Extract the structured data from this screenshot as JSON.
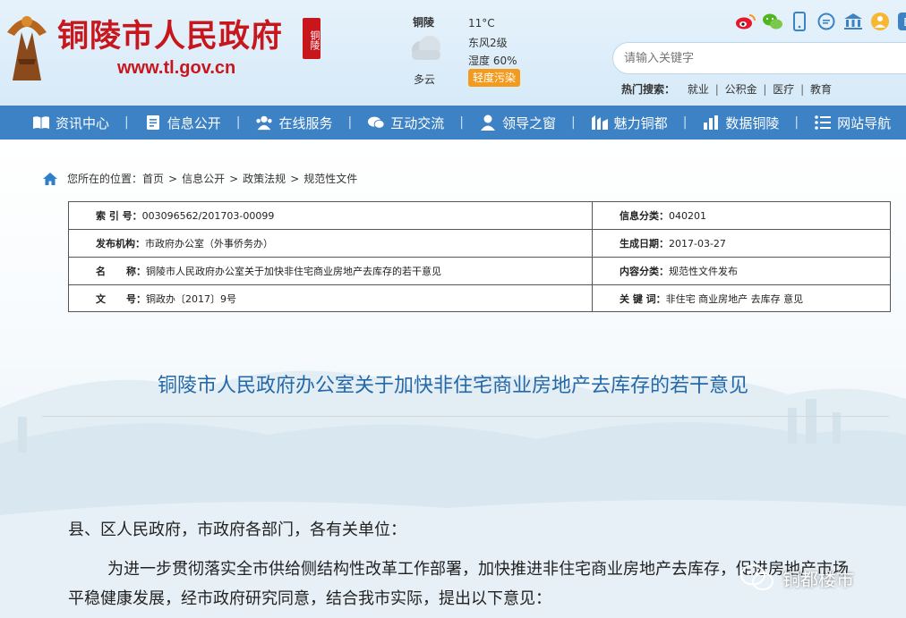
{
  "header": {
    "site_name": "铜陵市人民政府",
    "seal_text": "铜陵",
    "url": "www.tl.gov.cn"
  },
  "weather": {
    "city": "铜陵",
    "condition": "多云",
    "temperature": "11°C",
    "wind": "东风2级",
    "humidity": "湿度 60%",
    "air_quality": "轻度污染"
  },
  "search": {
    "placeholder": "请输入关键字",
    "hot_label": "热门搜索：",
    "hot_keywords": [
      "就业",
      "公积金",
      "医疗",
      "教育"
    ]
  },
  "social_icons": [
    "weibo-icon",
    "wechat-icon",
    "mobile-icon",
    "chat-icon",
    "gov-building-icon",
    "elderly-mode-icon",
    "english-icon"
  ],
  "nav": [
    {
      "label": "资讯中心",
      "icon": "book-icon"
    },
    {
      "label": "信息公开",
      "icon": "document-icon"
    },
    {
      "label": "在线服务",
      "icon": "people-icon"
    },
    {
      "label": "互动交流",
      "icon": "chat-bubble-icon"
    },
    {
      "label": "领导之窗",
      "icon": "user-icon"
    },
    {
      "label": "魅力铜都",
      "icon": "city-icon"
    },
    {
      "label": "数据铜陵",
      "icon": "bar-chart-icon"
    },
    {
      "label": "网站导航",
      "icon": "list-icon"
    }
  ],
  "breadcrumb": {
    "prefix": "您所在的位置：",
    "items": [
      "首页",
      "信息公开",
      "政策法规",
      "规范性文件"
    ]
  },
  "meta": {
    "rows": [
      {
        "left_key": "索 引 号：",
        "left_val": "003096562/201703-00099",
        "right_key": "信息分类：",
        "right_val": "040201"
      },
      {
        "left_key": "发布机构：",
        "left_val": "市政府办公室（外事侨务办）",
        "right_key": "生成日期：",
        "right_val": "2017-03-27"
      },
      {
        "left_key": "名      称：",
        "left_val": "铜陵市人民政府办公室关于加快非住宅商业房地产去库存的若干意见",
        "right_key": "内容分类：",
        "right_val": "规范性文件发布"
      },
      {
        "left_key": "文      号：",
        "left_val": "铜政办〔2017〕9号",
        "right_key": "关 键 词：",
        "right_val": "非住宅 商业房地产 去库存 意见"
      }
    ]
  },
  "article": {
    "title": "铜陵市人民政府办公室关于加快非住宅商业房地产去库存的若干意见",
    "salutation": "县、区人民政府，市政府各部门，各有关单位：",
    "body": "为进一步贯彻落实全市供给侧结构性改革工作部署，加快推进非住宅商业房地产去库存，促进房地产市场平稳健康发展，经市政府研究同意，结合我市实际，提出以下意见："
  },
  "watermark": {
    "text": "铜都楼市"
  },
  "colors": {
    "brand_red": "#c8161d",
    "nav_blue": "#3d82c4",
    "title_blue": "#2368a8",
    "aqi_orange": "#f39b1f"
  }
}
